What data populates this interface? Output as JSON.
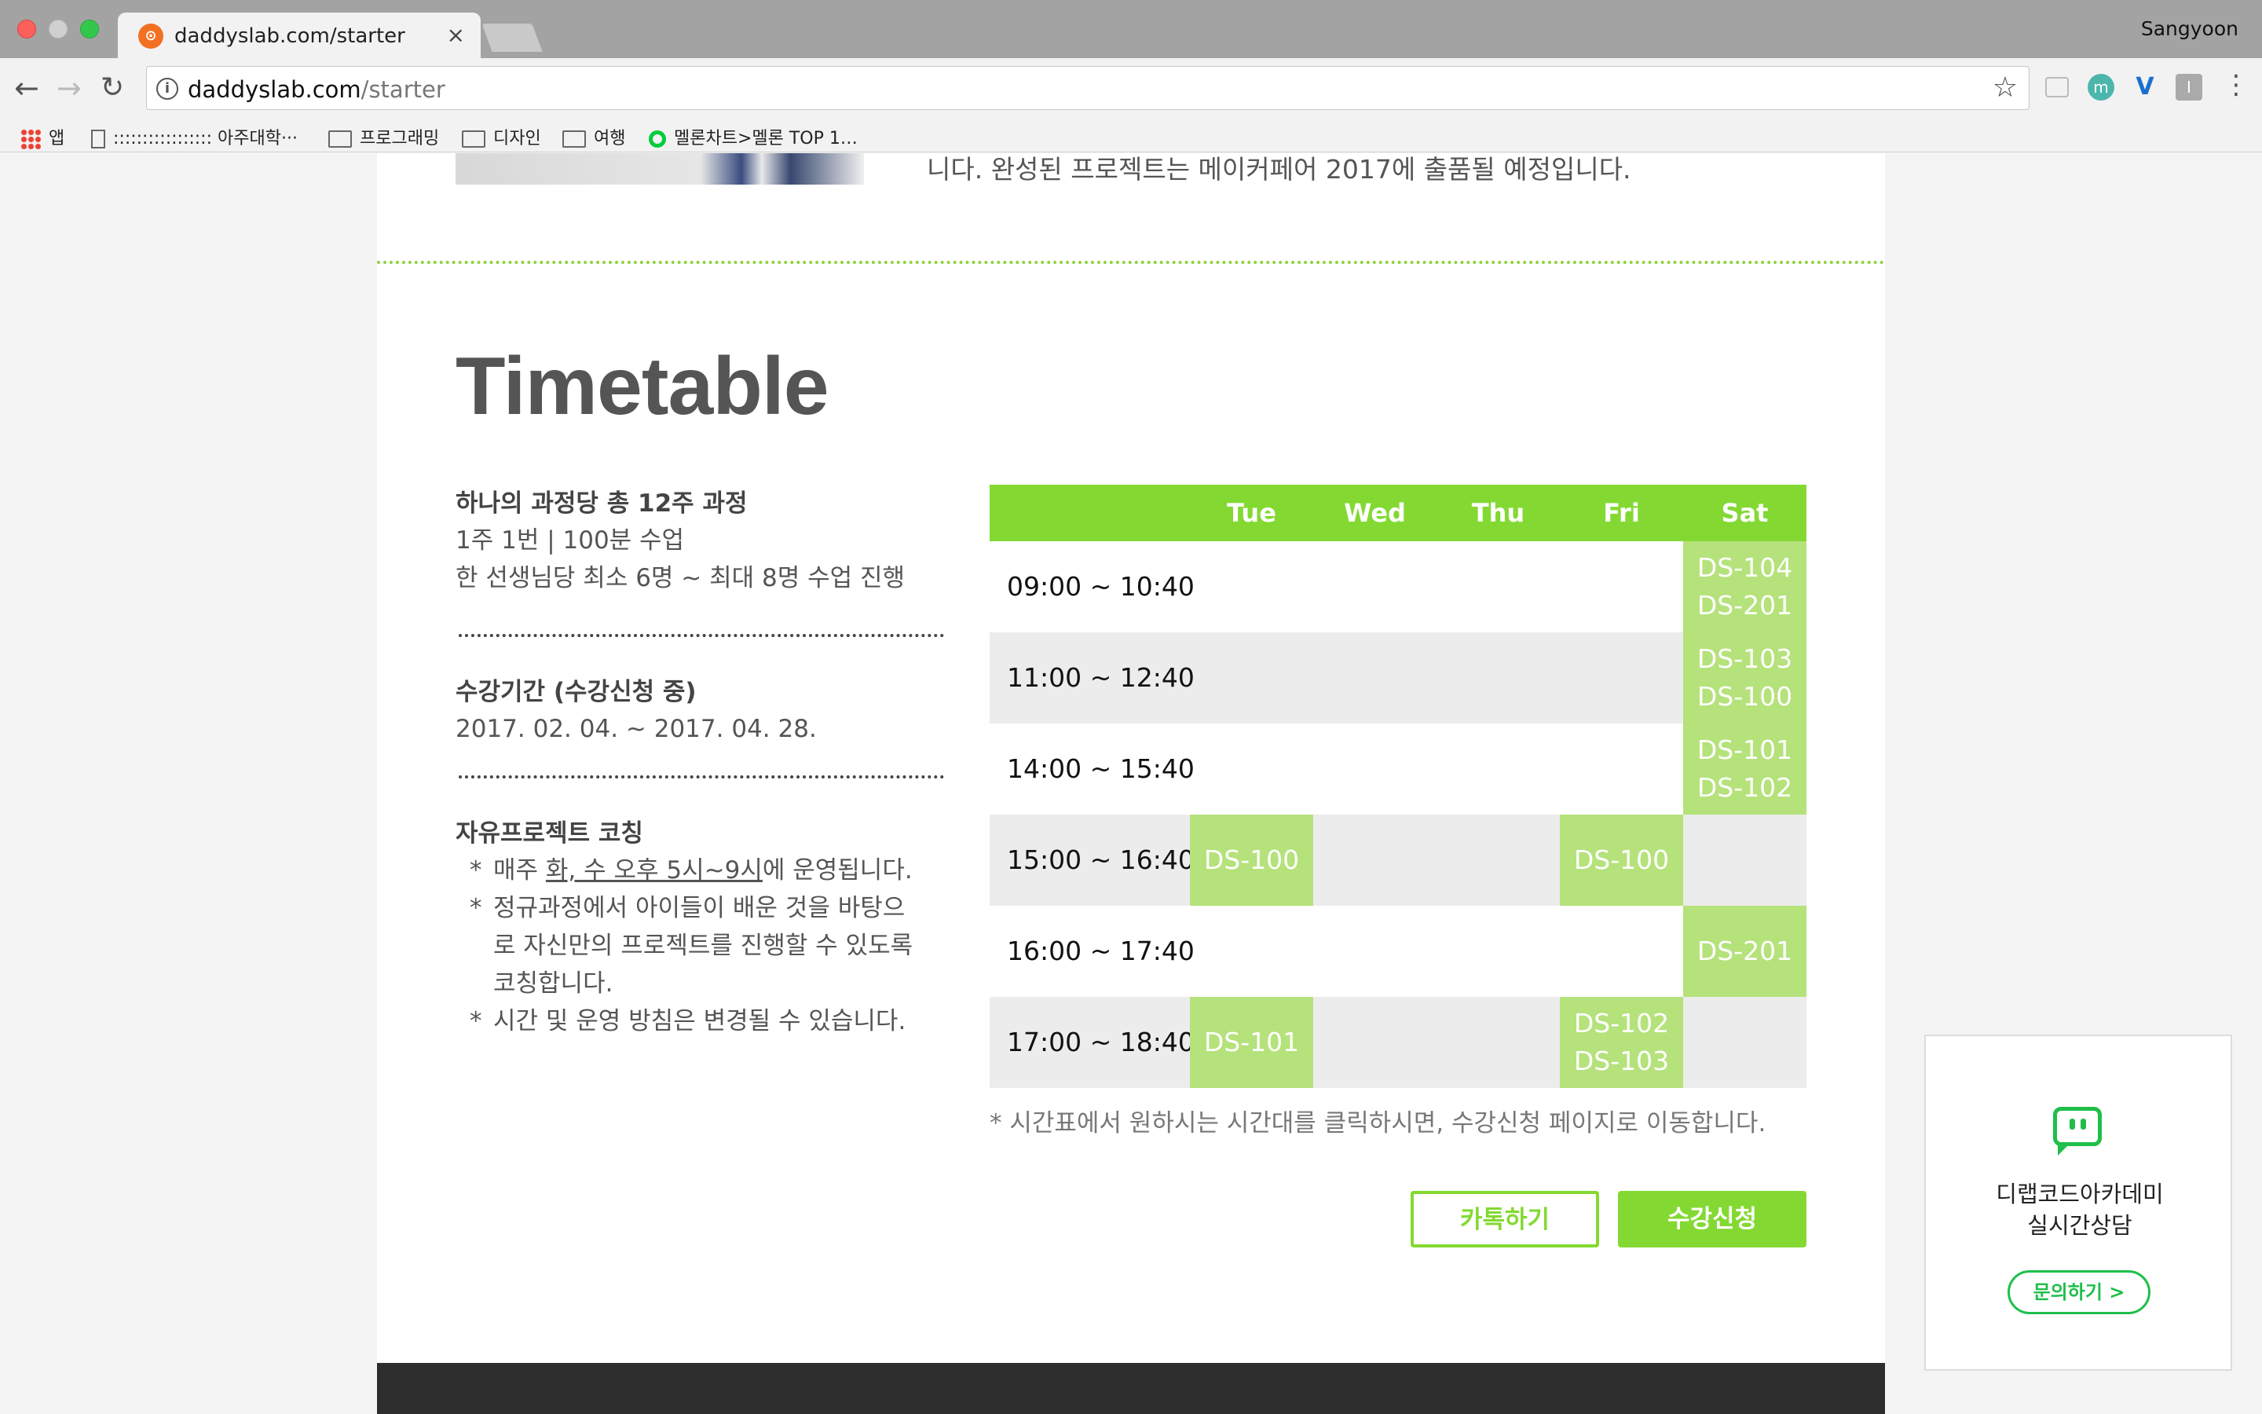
{
  "browser": {
    "tab_title": "daddyslab.com/starter",
    "profile": "Sangyoon",
    "url_host": "daddyslab.com",
    "url_path": "/starter",
    "bookmarks": [
      {
        "label": "앱",
        "icon": "apps-icon"
      },
      {
        "label": "::::::::::::::::: 아주대학···",
        "icon": "page-icon"
      },
      {
        "label": "프로그래밍",
        "icon": "folder-icon"
      },
      {
        "label": "디자인",
        "icon": "folder-icon"
      },
      {
        "label": "여행",
        "icon": "folder-icon"
      },
      {
        "label": "멜론차트>멜론 TOP 1…",
        "icon": "melon-icon"
      }
    ]
  },
  "page": {
    "intro_tail": "니다. 완성된 프로젝트는 메이커페어 2017에 출품될 예정입니다.",
    "title": "Timetable",
    "course": {
      "heading": "하나의 과정당 총 12주 과정",
      "line1": "1주 1번  |  100분 수업",
      "line2": "한 선생님당 최소 6명 ~ 최대 8명 수업 진행"
    },
    "period": {
      "heading": "수강기간 (수강신청 중)",
      "dates": "2017. 02. 04.  ~  2017. 04. 28."
    },
    "coaching": {
      "heading": "자유프로젝트 코칭",
      "note1_pre": "매주 ",
      "note1_underlined": "화, 수 오후 5시~9시",
      "note1_post": "에 운영됩니다.",
      "note2": "정규과정에서 아이들이 배운 것을 바탕으로 자신만의 프로젝트를 진행할 수 있도록 코칭합니다.",
      "note3": "시간 및 운영 방침은 변경될 수 있습니다."
    },
    "timetable": {
      "days": [
        "Tue",
        "Wed",
        "Thu",
        "Fri",
        "Sat"
      ],
      "rows": [
        {
          "time": "09:00 ~ 10:40",
          "Tue": "",
          "Fri": "",
          "Sat": "DS-104\nDS-201"
        },
        {
          "time": "11:00 ~ 12:40",
          "Tue": "",
          "Fri": "",
          "Sat": "DS-103\nDS-100"
        },
        {
          "time": "14:00 ~ 15:40",
          "Tue": "",
          "Fri": "",
          "Sat": "DS-101\nDS-102"
        },
        {
          "time": "15:00 ~ 16:40",
          "Tue": "DS-100",
          "Fri": "DS-100",
          "Sat": ""
        },
        {
          "time": "16:00 ~ 17:40",
          "Tue": "",
          "Fri": "",
          "Sat": "DS-201"
        },
        {
          "time": "17:00 ~ 18:40",
          "Tue": "DS-101",
          "Fri": "DS-102\nDS-103",
          "Sat": ""
        }
      ],
      "footnote": "* 시간표에서 원하시는 시간대를 클릭하시면, 수강신청 페이지로 이동합니다."
    },
    "buttons": {
      "kakao": "카톡하기",
      "apply": "수강신청"
    }
  },
  "chat_widget": {
    "line1": "디랩코드아카데미",
    "line2": "실시간상담",
    "button": "문의하기 >"
  },
  "colors": {
    "accent_green": "#83d932",
    "cell_green": "#b5e27b",
    "chat_green": "#1fbf4a"
  }
}
